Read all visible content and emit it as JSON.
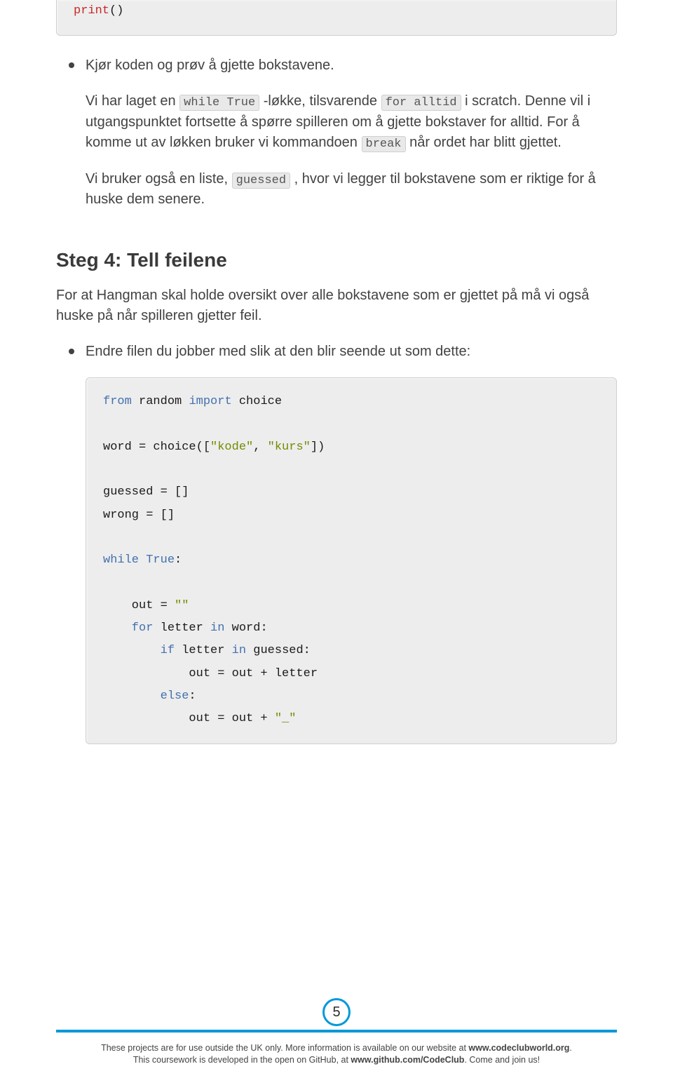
{
  "code_top": {
    "line1_kw": "print",
    "line1_rest": "()"
  },
  "bullets_top": {
    "item1": "Kjør koden og prøv å gjette bokstavene."
  },
  "para1_parts": {
    "pre_while": "Vi har laget en ",
    "while": "while True",
    "post_while": " -løkke, tilsvarende ",
    "for_alltid": "for alltid",
    "tail": " i scratch. Denne vil i utgangspunktet fortsette å spørre spilleren om å gjette bokstaver for alltid. For å komme ut av løkken bruker vi kommandoen ",
    "break": "break",
    "tail2": " når ordet har blitt gjettet."
  },
  "para2_parts": {
    "pre": "Vi bruker også en liste, ",
    "guessed": "guessed",
    "post": " , hvor vi legger til bokstavene som er riktige for å huske dem senere."
  },
  "section_title": "Steg 4: Tell feilene",
  "section_intro": "For at Hangman skal holde oversikt over alle bokstavene som er gjettet på må vi også huske på når spilleren gjetter feil.",
  "bullets_mid": {
    "item1": "Endre filen du jobber med slik at den blir seende ut som dette:"
  },
  "code_bottom": {
    "l1_from": "from",
    "l1_mid": " random ",
    "l1_import": "import",
    "l1_tail": " choice",
    "l3_a": "word = choice([",
    "l3_str1": "\"kode\"",
    "l3_mid": ", ",
    "l3_str2": "\"kurs\"",
    "l3_end": "])",
    "l5": "guessed = []",
    "l6": "wrong = []",
    "l8_while": "while",
    "l8_true": " True",
    "l8_colon": ":",
    "l10_a": "    out = ",
    "l10_str": "\"\"",
    "l11_for": "    for",
    "l11_mid": " letter ",
    "l11_in": "in",
    "l11_tail": " word:",
    "l12_if": "        if",
    "l12_mid": " letter ",
    "l12_in": "in",
    "l12_tail": " guessed:",
    "l13": "            out = out + letter",
    "l14_else": "        else",
    "l14_colon": ":",
    "l15_a": "            out = out + ",
    "l15_str": "\"_\""
  },
  "page_number": "5",
  "footer_line1_a": "These projects are for use outside the UK only. More information is available on our website at ",
  "footer_line1_b": "www.codeclubworld.org",
  "footer_line1_c": ".",
  "footer_line2_a": "This coursework is developed in the open on GitHub, at ",
  "footer_line2_b": "www.github.com/CodeClub",
  "footer_line2_c": ". Come and join us!"
}
